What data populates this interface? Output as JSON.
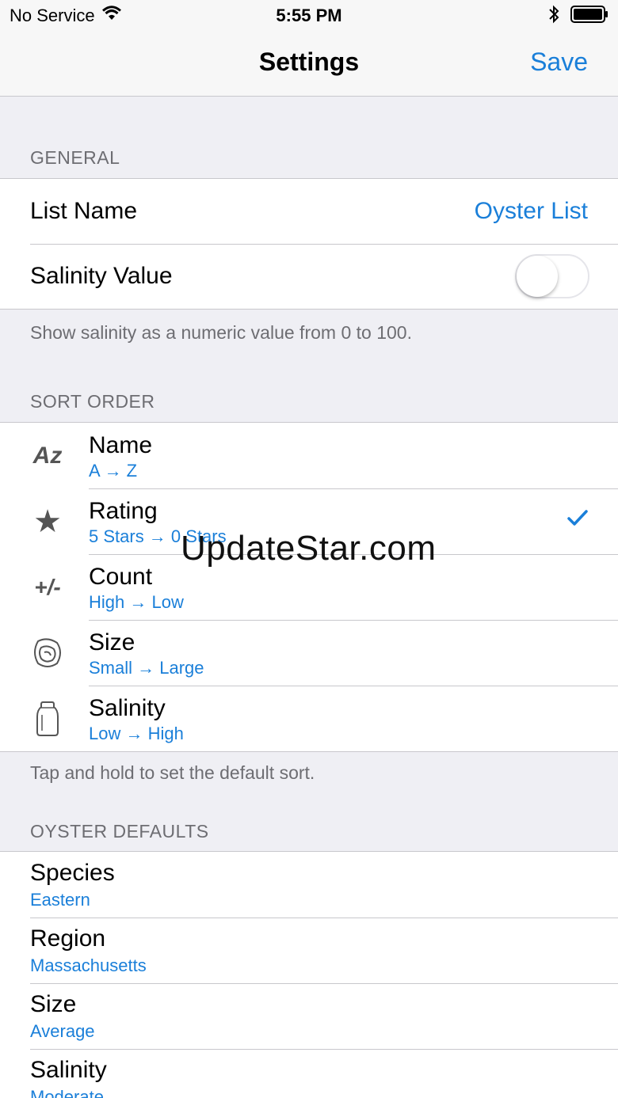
{
  "status_bar": {
    "carrier": "No Service",
    "time": "5:55 PM"
  },
  "nav": {
    "title": "Settings",
    "save_label": "Save"
  },
  "general": {
    "header": "GENERAL",
    "list_name": {
      "label": "List Name",
      "value": "Oyster List"
    },
    "salinity_value": {
      "label": "Salinity Value",
      "enabled": false
    },
    "footer": "Show salinity as a numeric value from 0 to 100."
  },
  "sort_order": {
    "header": "SORT ORDER",
    "items": [
      {
        "icon": "az-icon",
        "icon_text": "Az",
        "label": "Name",
        "detail": "A → Z",
        "selected": false
      },
      {
        "icon": "star-icon",
        "icon_text": "★",
        "label": "Rating",
        "detail": "5 Stars → 0 Stars",
        "selected": true
      },
      {
        "icon": "plus-minus-icon",
        "icon_text": "+/-",
        "label": "Count",
        "detail": "High → Low",
        "selected": false
      },
      {
        "icon": "oyster-icon",
        "label": "Size",
        "detail": "Small → Large",
        "selected": false
      },
      {
        "icon": "salt-shaker-icon",
        "label": "Salinity",
        "detail": "Low → High",
        "selected": false
      }
    ],
    "footer": "Tap and hold to set the default sort."
  },
  "oyster_defaults": {
    "header": "OYSTER DEFAULTS",
    "items": [
      {
        "label": "Species",
        "value": "Eastern"
      },
      {
        "label": "Region",
        "value": "Massachusetts"
      },
      {
        "label": "Size",
        "value": "Average"
      },
      {
        "label": "Salinity",
        "value": "Moderate"
      }
    ]
  },
  "watermark": "UpdateStar.com",
  "colors": {
    "accent": "#1a7fd9",
    "background": "#efeff4",
    "separator": "#c8c7cc",
    "header_text": "#6d6d72"
  }
}
